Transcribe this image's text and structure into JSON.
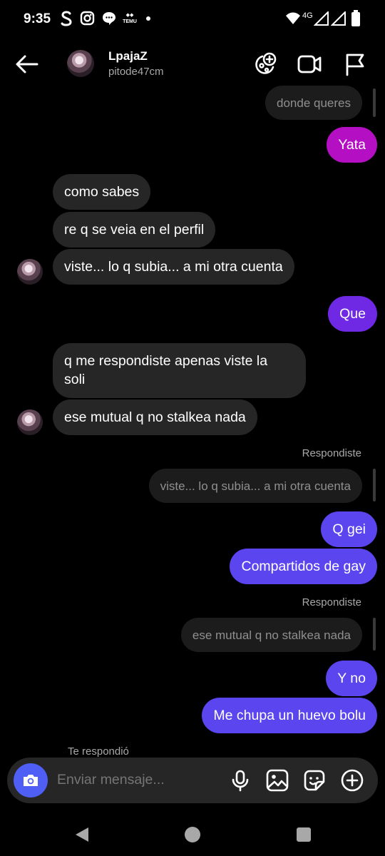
{
  "status_bar": {
    "time": "9:35",
    "network": "4G",
    "notification_icons": [
      "s-app-icon",
      "instagram-icon",
      "messages-icon",
      "temu-icon",
      "dot-icon"
    ],
    "temu_text": "TEMU"
  },
  "header": {
    "name": "LpajaZ",
    "username": "pitode47cm"
  },
  "messages": [
    {
      "text": "donde queres",
      "type": "replied-preview"
    },
    {
      "text": "Yata",
      "type": "sent"
    },
    {
      "text": "como sabes",
      "type": "received"
    },
    {
      "text": "re q se veia en el perfil",
      "type": "received"
    },
    {
      "text": "viste... lo q subia... a mi otra cuenta",
      "type": "received"
    },
    {
      "text": "Que",
      "type": "sent"
    },
    {
      "text_line1": "q me respondiste apenas viste la",
      "text_line2": "soli",
      "type": "received"
    },
    {
      "text": "ese mutual q no stalkea nada",
      "type": "received"
    },
    {
      "reply_label": "Respondiste",
      "text": "viste... lo q subia... a mi otra cuenta",
      "type": "replied-preview"
    },
    {
      "text": "Q gei",
      "type": "sent"
    },
    {
      "text": "Compartidos de gay",
      "type": "sent"
    },
    {
      "reply_label": "Respondiste",
      "text": "ese mutual q no stalkea nada",
      "type": "replied-preview"
    },
    {
      "text": "Y no",
      "type": "sent"
    },
    {
      "text": "Me chupa un huevo bolu",
      "type": "sent"
    }
  ],
  "composer": {
    "replied_label": "Te respondió",
    "placeholder": "Enviar mensaje..."
  },
  "colors": {
    "background": "#000000",
    "received_bubble": "#262626",
    "sent_pink": "#b40fc3",
    "sent_purple": "#6f28e4",
    "sent_blue": "#5a45ee",
    "camera_button": "#4f5ef5"
  }
}
